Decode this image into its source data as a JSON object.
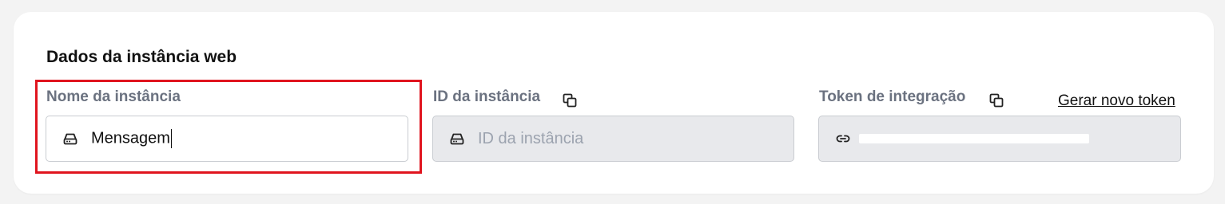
{
  "section": {
    "title": "Dados da instância web"
  },
  "instance_name": {
    "label": "Nome da instância",
    "value": "Mensagem",
    "icon": "hard-drive-icon"
  },
  "instance_id": {
    "label": "ID da instância",
    "placeholder": "ID da instância",
    "icon": "hard-drive-icon",
    "copy_icon": "copy-icon"
  },
  "integration_token": {
    "label": "Token de integração",
    "icon": "link-icon",
    "copy_icon": "copy-icon",
    "regenerate_label": "Gerar novo token"
  },
  "colors": {
    "highlight": "#e0141e",
    "label": "#6b7280",
    "readonly_bg": "#e8e9ec"
  }
}
